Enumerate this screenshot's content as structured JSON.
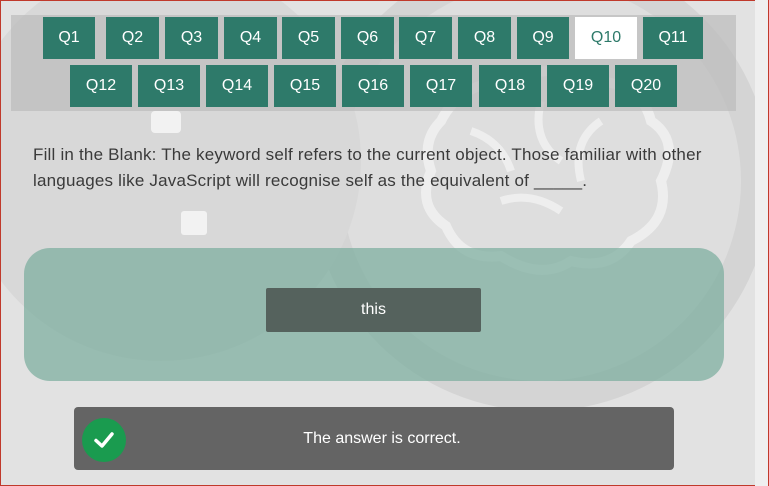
{
  "nav": {
    "row1": [
      {
        "label": "Q1"
      },
      {
        "label": "Q2"
      },
      {
        "label": "Q3"
      },
      {
        "label": "Q4"
      },
      {
        "label": "Q5"
      },
      {
        "label": "Q6"
      },
      {
        "label": "Q7"
      },
      {
        "label": "Q8"
      },
      {
        "label": "Q9"
      },
      {
        "label": "Q10"
      },
      {
        "label": "Q11"
      }
    ],
    "row2": [
      {
        "label": "Q12"
      },
      {
        "label": "Q13"
      },
      {
        "label": "Q14"
      },
      {
        "label": "Q15"
      },
      {
        "label": "Q16"
      },
      {
        "label": "Q17"
      },
      {
        "label": "Q18"
      },
      {
        "label": "Q19"
      },
      {
        "label": "Q20"
      }
    ],
    "active": "Q10"
  },
  "question": {
    "text": "Fill in the Blank: The keyword self refers to the current object. Those familiar with other languages like JavaScript will recognise self as the equivalent of _____."
  },
  "answer": {
    "option_label": "this"
  },
  "feedback": {
    "message": "The answer is correct.",
    "status_icon": "check-icon"
  },
  "colors": {
    "accent": "#2e7a6a",
    "success": "#1a9b4f",
    "feedback_bg": "#646464"
  }
}
